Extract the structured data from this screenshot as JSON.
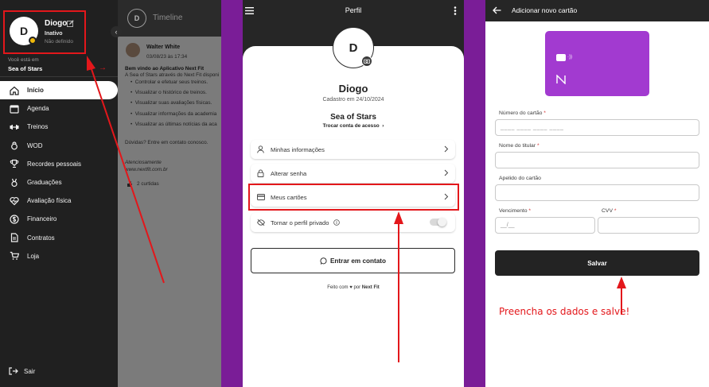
{
  "drawer": {
    "avatar_initial": "D",
    "user_name": "Diogo",
    "user_status": "Inativo",
    "user_plan": "Não definido",
    "location_caption": "Você está em",
    "location_name": "Sea of Stars",
    "items": [
      {
        "label": "Início",
        "icon": "home-icon",
        "active": true
      },
      {
        "label": "Agenda",
        "icon": "calendar-icon",
        "active": false
      },
      {
        "label": "Treinos",
        "icon": "dumbbell-icon",
        "active": false
      },
      {
        "label": "WOD",
        "icon": "kettlebell-icon",
        "active": false
      },
      {
        "label": "Recordes pessoais",
        "icon": "trophy-icon",
        "active": false
      },
      {
        "label": "Graduações",
        "icon": "medal-icon",
        "active": false
      },
      {
        "label": "Avaliação física",
        "icon": "heart-pulse-icon",
        "active": false
      },
      {
        "label": "Financeiro",
        "icon": "dollar-icon",
        "active": false
      },
      {
        "label": "Contratos",
        "icon": "document-icon",
        "active": false
      },
      {
        "label": "Loja",
        "icon": "cart-icon",
        "active": false
      }
    ],
    "logout_label": "Sair"
  },
  "timeline": {
    "title": "Timeline",
    "post_author": "Walter White",
    "post_datetime": "03/08/23 às 17:34",
    "post_heading": "Bem vindo ao Aplicativo Next Fit",
    "post_intro": "A Sea of Stars através do Next Fit disponi",
    "bullets": [
      "Controlar e efetuar seus treinos.",
      "Visualizar o histórico de treinos.",
      "Visualizar suas avaliações físicas.",
      "Visualizar informações da academia",
      "Visualizar as últimas notícias da aca"
    ],
    "post_contact": "Dúvidas? Entre em contato conosco.",
    "post_signoff": "Atenciosamente",
    "post_site": "www.nextfit.com.br",
    "likes": "2 curtidas"
  },
  "profile": {
    "header_title": "Perfil",
    "avatar_initial": "D",
    "name": "Diogo",
    "registered": "Cadastro em 24/10/2024",
    "gym": "Sea of Stars",
    "switch_account": "Trocar conta de acesso",
    "menu": [
      {
        "label": "Minhas informações",
        "icon": "user-icon"
      },
      {
        "label": "Alterar senha",
        "icon": "lock-icon"
      },
      {
        "label": "Meus cartões",
        "icon": "credit-card-icon"
      }
    ],
    "private_label": "Tornar o perfil privado",
    "contact_button": "Entrar em contato",
    "footer_prefix": "Feito com",
    "footer_middle": "por",
    "footer_brand": "Next Fit"
  },
  "add_card": {
    "header_title": "Adicionar novo cartão",
    "fields": {
      "card_number": {
        "label": "Número do cartão",
        "placeholder": "____ ____ ____ ____"
      },
      "holder_name": {
        "label": "Nome do titular",
        "placeholder": ""
      },
      "card_nickname": {
        "label": "Apelido do cartão",
        "placeholder": ""
      },
      "expiry": {
        "label": "Vencimento",
        "placeholder": "__/__"
      },
      "cvv": {
        "label": "CVV",
        "placeholder": ""
      }
    },
    "required_mark": "*",
    "save_button": "Salvar",
    "annotation": "Preencha os dados e salve!"
  },
  "colors": {
    "accent_purple": "#7a1d97",
    "card_purple": "#a23ad0",
    "annotation_red": "#e3171b",
    "dark": "#202020"
  }
}
